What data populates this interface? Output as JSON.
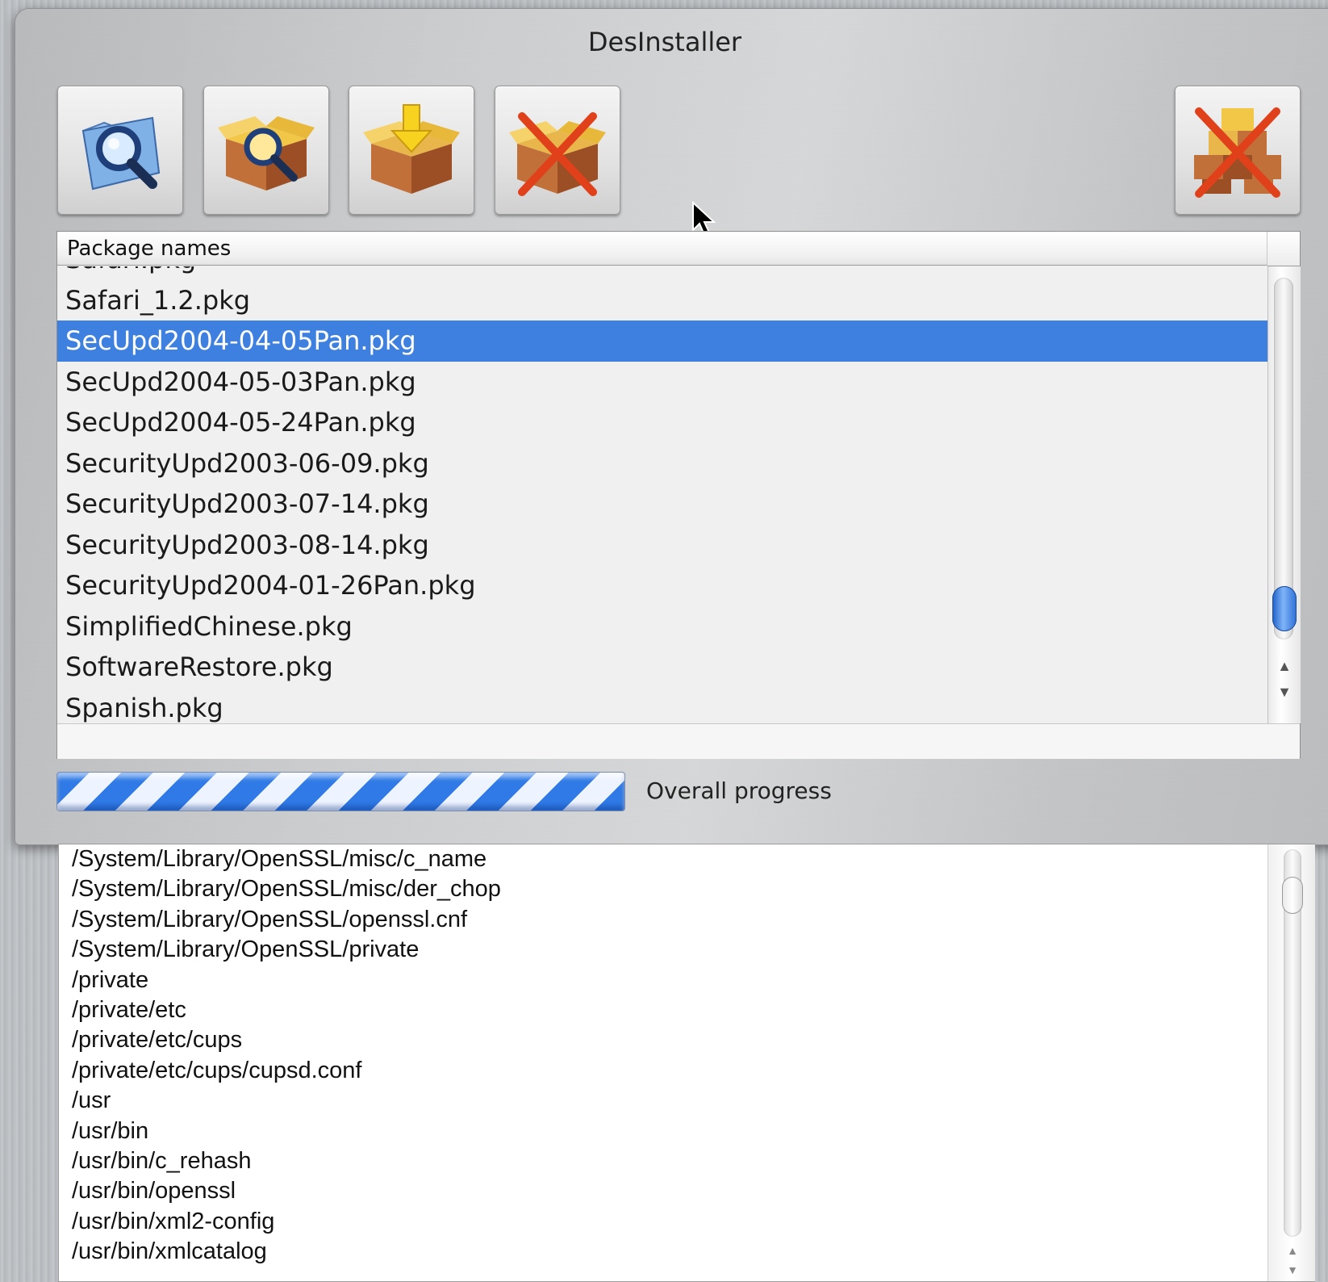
{
  "window": {
    "title": "DesInstaller"
  },
  "toolbar": {
    "buttons": [
      {
        "name": "open-receipt-button",
        "icon": "folder-magnifier-icon"
      },
      {
        "name": "inspect-package-button",
        "icon": "package-magnifier-icon"
      },
      {
        "name": "install-package-button",
        "icon": "package-arrow-icon"
      },
      {
        "name": "remove-package-button",
        "icon": "package-cross-icon"
      },
      {
        "name": "remove-all-button",
        "icon": "stacked-packages-cross-icon"
      }
    ]
  },
  "package_list": {
    "column_header": "Package names",
    "rows": [
      "Safari.pkg",
      "Safari_1.2.pkg",
      "SecUpd2004-04-05Pan.pkg",
      "SecUpd2004-05-03Pan.pkg",
      "SecUpd2004-05-24Pan.pkg",
      "SecurityUpd2003-06-09.pkg",
      "SecurityUpd2003-07-14.pkg",
      "SecurityUpd2003-08-14.pkg",
      "SecurityUpd2004-01-26Pan.pkg",
      "SimplifiedChinese.pkg",
      "SoftwareRestore.pkg",
      "Spanish.pkg"
    ],
    "selected": "SecUpd2004-04-05Pan.pkg"
  },
  "progress": {
    "label": "Overall progress",
    "state": "indeterminate"
  },
  "file_list": {
    "rows": [
      "/System/Library/OpenSSL/misc/c_name",
      "/System/Library/OpenSSL/misc/der_chop",
      "/System/Library/OpenSSL/openssl.cnf",
      "/System/Library/OpenSSL/private",
      "/private",
      "/private/etc",
      "/private/etc/cups",
      "/private/etc/cups/cupsd.conf",
      "/usr",
      "/usr/bin",
      "/usr/bin/c_rehash",
      "/usr/bin/openssl",
      "/usr/bin/xml2-config",
      "/usr/bin/xmlcatalog"
    ]
  },
  "colors": {
    "selection": "#3d80df",
    "progress_stripe": "#2f7ae6",
    "remove_cross": "#e0401a"
  }
}
